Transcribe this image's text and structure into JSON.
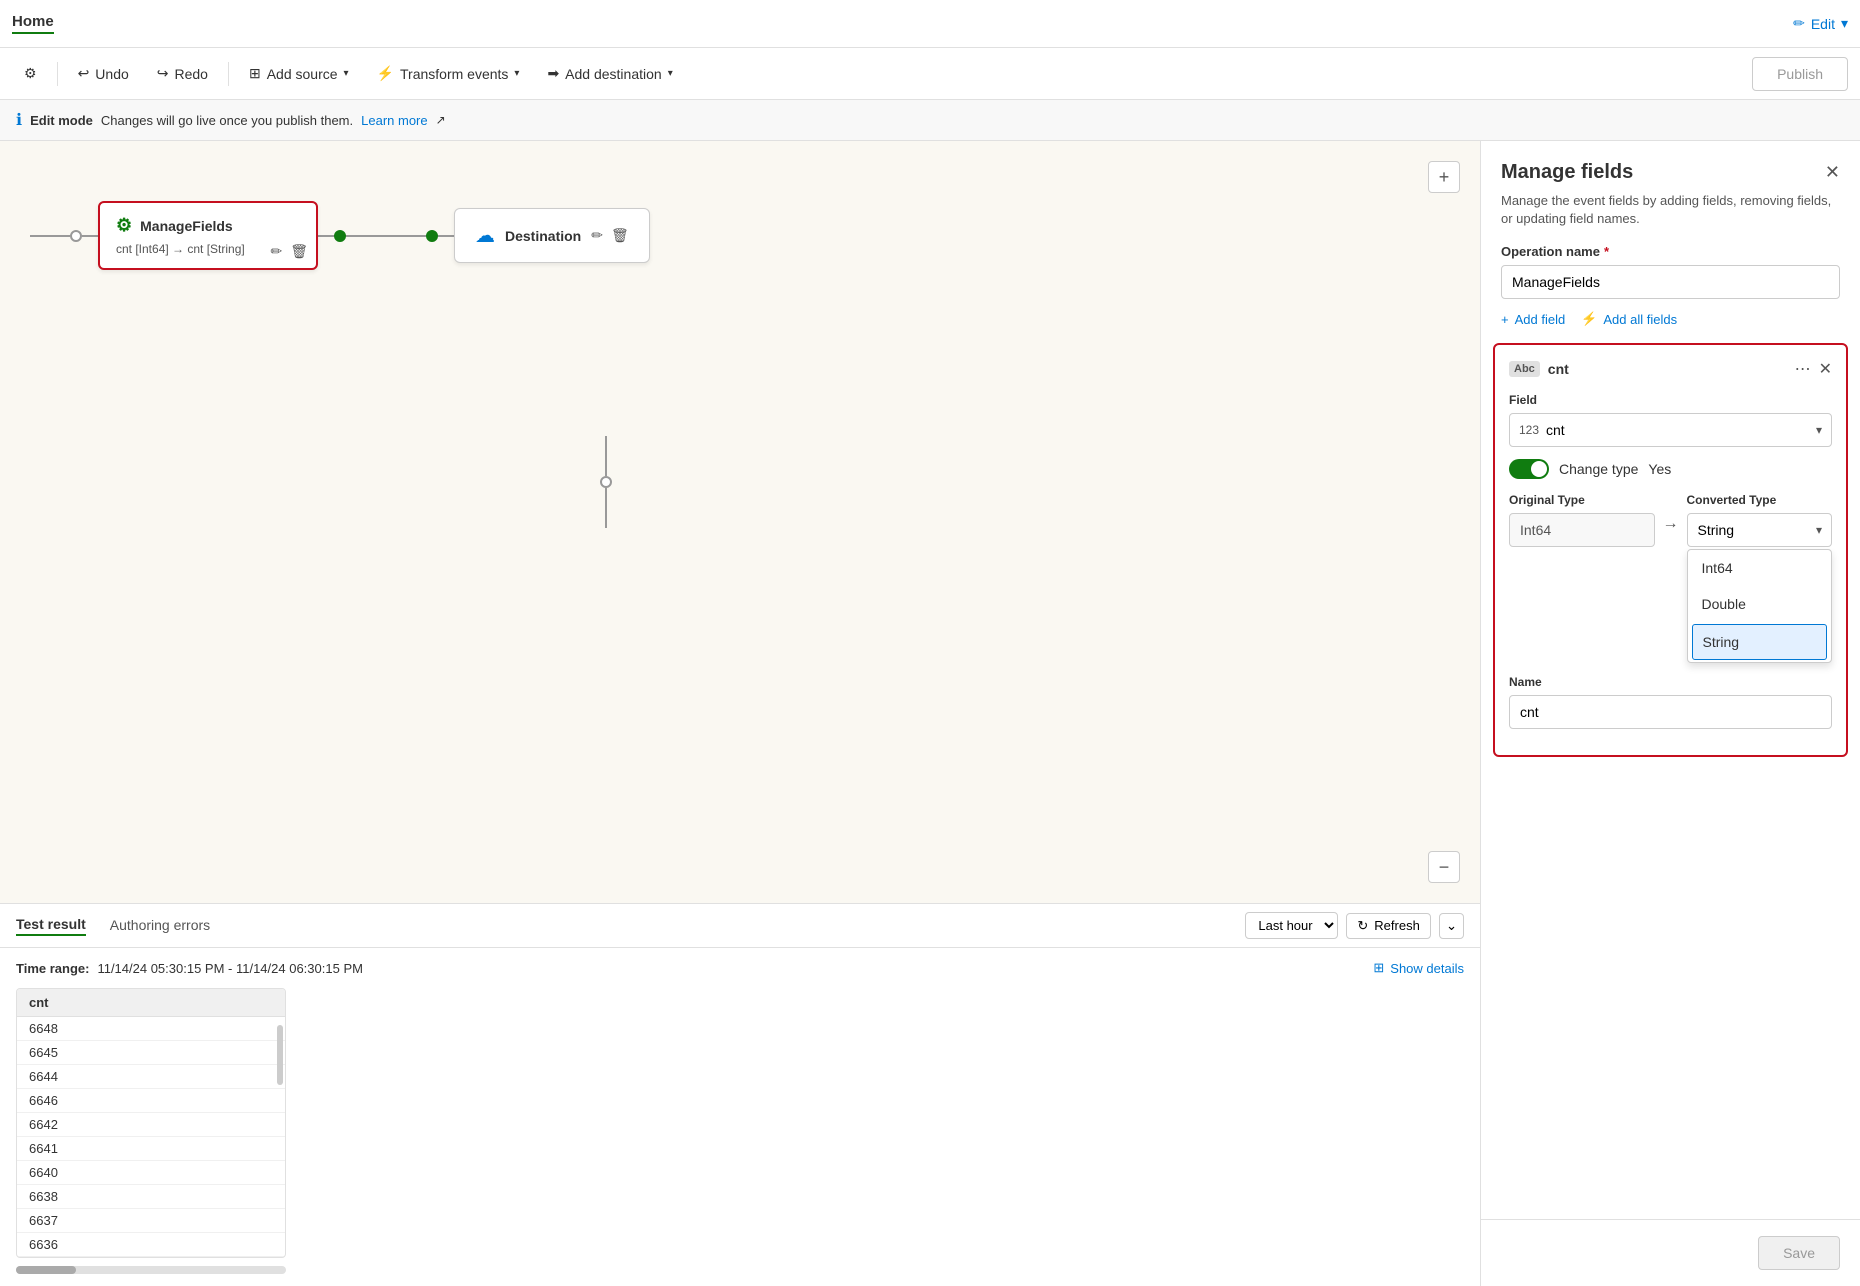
{
  "topbar": {
    "home_label": "Home",
    "edit_label": "Edit",
    "edit_icon": "✏"
  },
  "toolbar": {
    "settings_icon": "⚙",
    "undo_label": "Undo",
    "redo_label": "Redo",
    "add_source_label": "Add source",
    "transform_events_label": "Transform events",
    "add_destination_label": "Add destination",
    "publish_label": "Publish"
  },
  "infobar": {
    "mode_label": "Edit mode",
    "desc": "Changes will go live once you publish them.",
    "learn_more": "Learn more"
  },
  "canvas": {
    "manage_fields_node": {
      "title": "ManageFields",
      "subtitle": "cnt [Int64] → cnt [String]"
    },
    "destination_node": {
      "title": "Destination"
    }
  },
  "bottom_panel": {
    "tab_test_result": "Test result",
    "tab_authoring_errors": "Authoring errors",
    "time_select_value": "Last hour",
    "refresh_label": "Refresh",
    "time_range_label": "Time range:",
    "time_range_value": "11/14/24 05:30:15 PM - 11/14/24 06:30:15 PM",
    "show_details_label": "Show details",
    "table_header": "cnt",
    "table_rows": [
      "6648",
      "6645",
      "6644",
      "6646",
      "6642",
      "6641",
      "6640",
      "6638",
      "6637",
      "6636"
    ]
  },
  "right_panel": {
    "title": "Manage fields",
    "description": "Manage the event fields by adding fields, removing fields, or updating field names.",
    "operation_name_label": "Operation name",
    "required_marker": "*",
    "operation_name_value": "ManageFields",
    "add_field_label": "Add field",
    "add_all_fields_label": "Add all fields",
    "field_card": {
      "type_icon": "Abc",
      "name": "cnt",
      "field_section_label": "Field",
      "field_value": "cnt",
      "field_icon": "123",
      "change_type_label": "Change type",
      "toggle_value": "Yes",
      "original_type_label": "Original Type",
      "original_type_value": "Int64",
      "converted_type_label": "Converted Type",
      "converted_type_value": "String",
      "name_label": "Name",
      "name_value": "cnt",
      "dropdown_options": [
        "Int64",
        "Double",
        "String"
      ]
    },
    "save_label": "Save"
  }
}
